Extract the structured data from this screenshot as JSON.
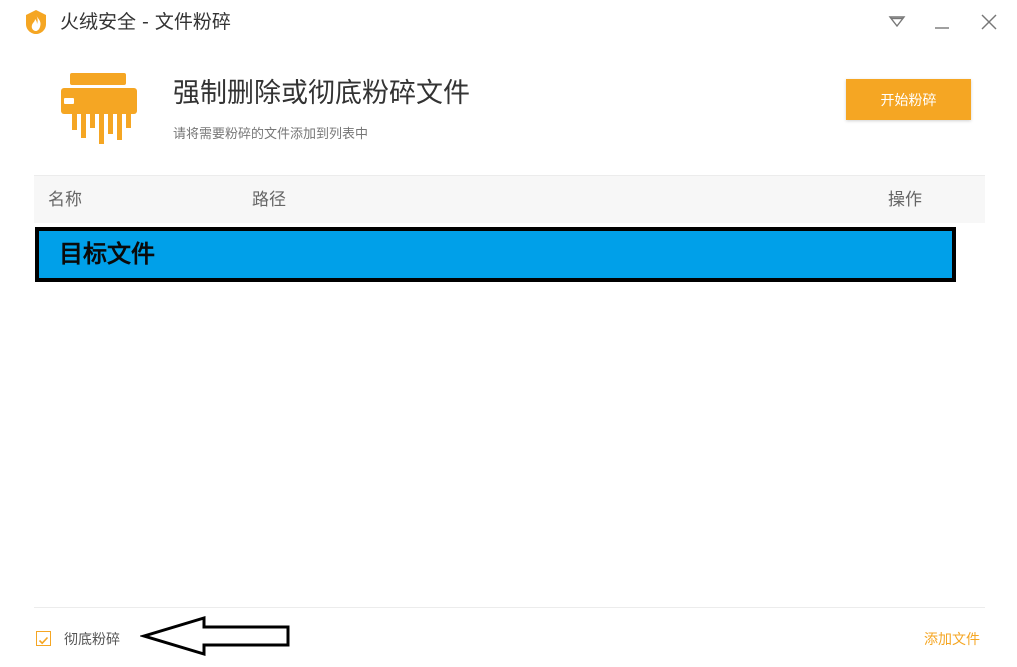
{
  "window": {
    "title": "火绒安全 - 文件粉碎",
    "logo_icon": "huorong-flame-icon",
    "controls": [
      "menu-dropdown-icon",
      "minimize-icon",
      "close-icon"
    ]
  },
  "header": {
    "icon": "shredder-icon",
    "title": "强制删除或彻底粉碎文件",
    "subtitle": "请将需要粉碎的文件添加到列表中",
    "start_button": "开始粉碎"
  },
  "table": {
    "columns": [
      "名称",
      "路径",
      "操作"
    ],
    "highlight_label": "目标文件"
  },
  "footer": {
    "checkbox_label": "彻底粉碎",
    "checkbox_checked": true,
    "add_file_link": "添加文件",
    "annotation": "left-arrow-outline"
  },
  "colors": {
    "accent": "#f5a623",
    "highlight_fill": "#00a0e9",
    "highlight_border": "#000000"
  }
}
